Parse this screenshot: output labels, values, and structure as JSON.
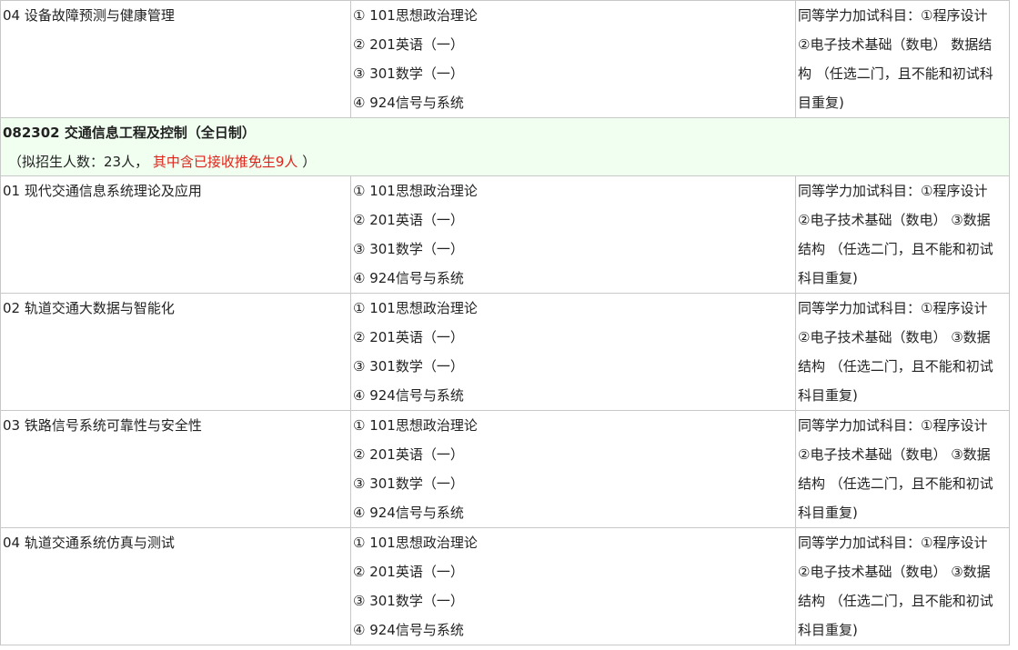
{
  "first_row": {
    "direction": "04 设备故障预测与健康管理",
    "exams": [
      "① 101思想政治理论",
      "② 201英语（一）",
      "③ 301数学（一）",
      "④ 924信号与系统"
    ],
    "notes": [
      "同等学力加试科目：①程序设计",
      "②电子技术基础（数电） 数据结",
      "构 （任选二门，且不能和初试科",
      "目重复)"
    ]
  },
  "section": {
    "title": "082302 交通信息工程及控制（全日制）",
    "enroll_prefix": "（拟招生人数：23人，",
    "enroll_red": "其中含已接收推免生9人",
    "enroll_suffix": "）"
  },
  "rows": [
    {
      "direction": "01 现代交通信息系统理论及应用",
      "exams": [
        "① 101思想政治理论",
        "② 201英语（一）",
        "③ 301数学（一）",
        "④ 924信号与系统"
      ],
      "notes": [
        "同等学力加试科目：①程序设计",
        "②电子技术基础（数电） ③数据",
        "结构 （任选二门，且不能和初试",
        "科目重复)"
      ]
    },
    {
      "direction": "02 轨道交通大数据与智能化",
      "exams": [
        "① 101思想政治理论",
        "② 201英语（一）",
        "③ 301数学（一）",
        "④ 924信号与系统"
      ],
      "notes": [
        "同等学力加试科目：①程序设计",
        "②电子技术基础（数电） ③数据",
        "结构 （任选二门，且不能和初试",
        "科目重复)"
      ]
    },
    {
      "direction": "03 铁路信号系统可靠性与安全性",
      "exams": [
        "① 101思想政治理论",
        "② 201英语（一）",
        "③ 301数学（一）",
        "④ 924信号与系统"
      ],
      "notes": [
        "同等学力加试科目：①程序设计",
        "②电子技术基础（数电） ③数据",
        "结构 （任选二门，且不能和初试",
        "科目重复)"
      ]
    },
    {
      "direction": "04 轨道交通系统仿真与测试",
      "exams": [
        "① 101思想政治理论",
        "② 201英语（一）",
        "③ 301数学（一）",
        "④ 924信号与系统"
      ],
      "notes": [
        "同等学力加试科目：①程序设计",
        "②电子技术基础（数电） ③数据",
        "结构 （任选二门，且不能和初试",
        "科目重复)"
      ]
    }
  ]
}
